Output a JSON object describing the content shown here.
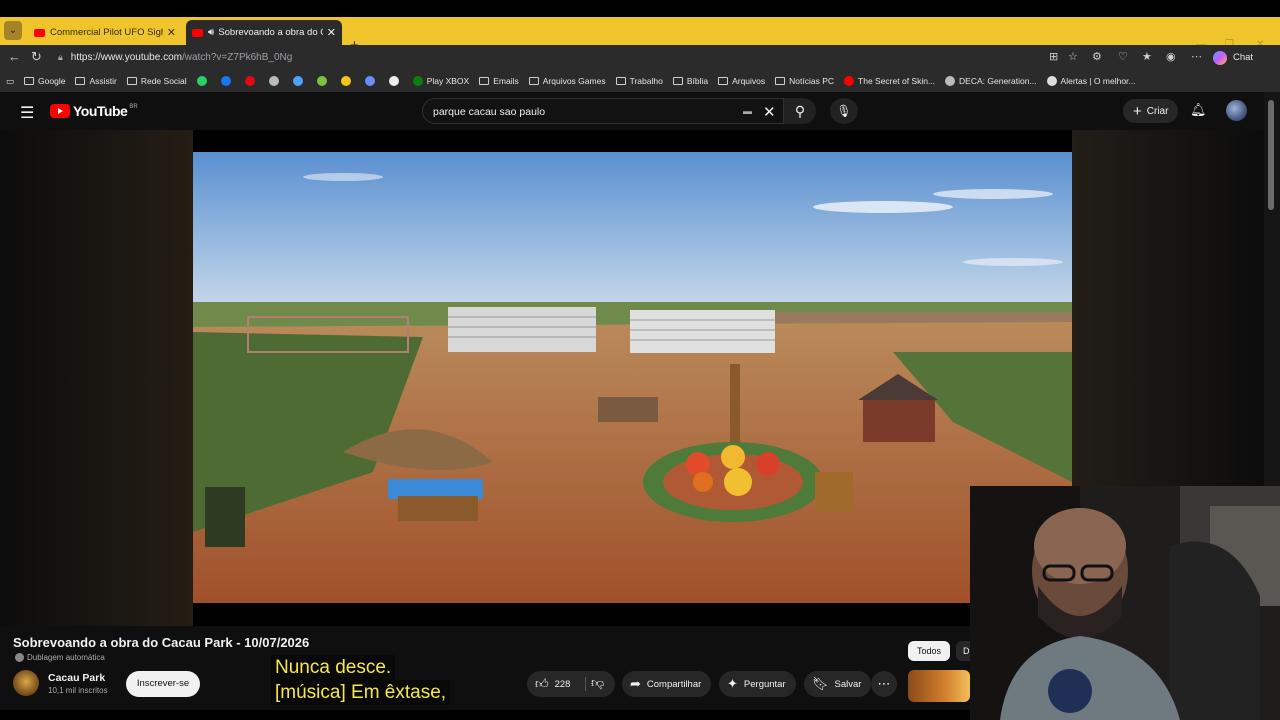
{
  "browser": {
    "tabs": [
      {
        "title": "Commercial Pilot UFO Sightings (Det",
        "active": false
      },
      {
        "title": "Sobrevoando a obra do Cacau",
        "active": true
      }
    ],
    "url_host": "https://www.youtube.com",
    "url_path": "/watch?v=Z7Pk6hB_0Ng",
    "chat_label": "Chat",
    "bookmarks": [
      {
        "label": "Google",
        "icon": "folder-icon"
      },
      {
        "label": "Assistir",
        "icon": "folder-icon"
      },
      {
        "label": "Rede Social",
        "icon": "folder-icon"
      },
      {
        "label": "",
        "icon": "whatsapp-icon",
        "color": "#25d366"
      },
      {
        "label": "",
        "icon": "messenger-icon",
        "color": "#1877f2"
      },
      {
        "label": "",
        "icon": "netflix-icon",
        "color": "#e50914"
      },
      {
        "label": "",
        "icon": "app-icon",
        "color": "#bbbbbb"
      },
      {
        "label": "",
        "icon": "ai-icon",
        "color": "#4aa3ff"
      },
      {
        "label": "",
        "icon": "android-icon",
        "color": "#7cc242"
      },
      {
        "label": "",
        "icon": "wallet-icon",
        "color": "#f5c518"
      },
      {
        "label": "",
        "icon": "chart-icon",
        "color": "#6a8cff"
      },
      {
        "label": "",
        "icon": "s-icon",
        "color": "#eeeeee"
      },
      {
        "label": "Play XBOX",
        "icon": "xbox-icon",
        "color": "#107c10"
      },
      {
        "label": "Emails",
        "icon": "folder-icon"
      },
      {
        "label": "Arquivos Games",
        "icon": "folder-icon"
      },
      {
        "label": "Trabalho",
        "icon": "folder-icon"
      },
      {
        "label": "Bíblia",
        "icon": "folder-icon"
      },
      {
        "label": "Arquivos",
        "icon": "folder-icon"
      },
      {
        "label": "Notícias PC",
        "icon": "folder-icon"
      },
      {
        "label": "The Secret of Skin...",
        "icon": "youtube-icon",
        "color": "#ff0000"
      },
      {
        "label": "DECA: Generation...",
        "icon": "globe-icon",
        "color": "#bbbbbb"
      },
      {
        "label": "Alertas | O melhor...",
        "icon": "alert-icon",
        "color": "#dddddd"
      }
    ]
  },
  "youtube": {
    "logo_text": "YouTube",
    "region": "BR",
    "search_query": "parque cacau sao paulo",
    "create_label": "Criar",
    "video_title": "Sobrevoando a obra do Cacau Park - 10/07/2026",
    "dub_label": "Dublagem automática",
    "channel_name": "Cacau Park",
    "channel_subs": "10,1 mil inscritos",
    "subscribe_label": "Inscrever-se",
    "like_count": "228",
    "share_label": "Compartilhar",
    "ask_label": "Perguntar",
    "save_label": "Salvar",
    "chip_all": "Todos",
    "chip_next": "D",
    "caption_line1": "Nunca desce.",
    "caption_line2": "[música] Em êxtase,"
  },
  "colors": {
    "tab_bar": "#f0c52b",
    "youtube_red": "#ff0000",
    "caption_text": "#f5e84a",
    "page_bg": "#0f0f0f"
  }
}
